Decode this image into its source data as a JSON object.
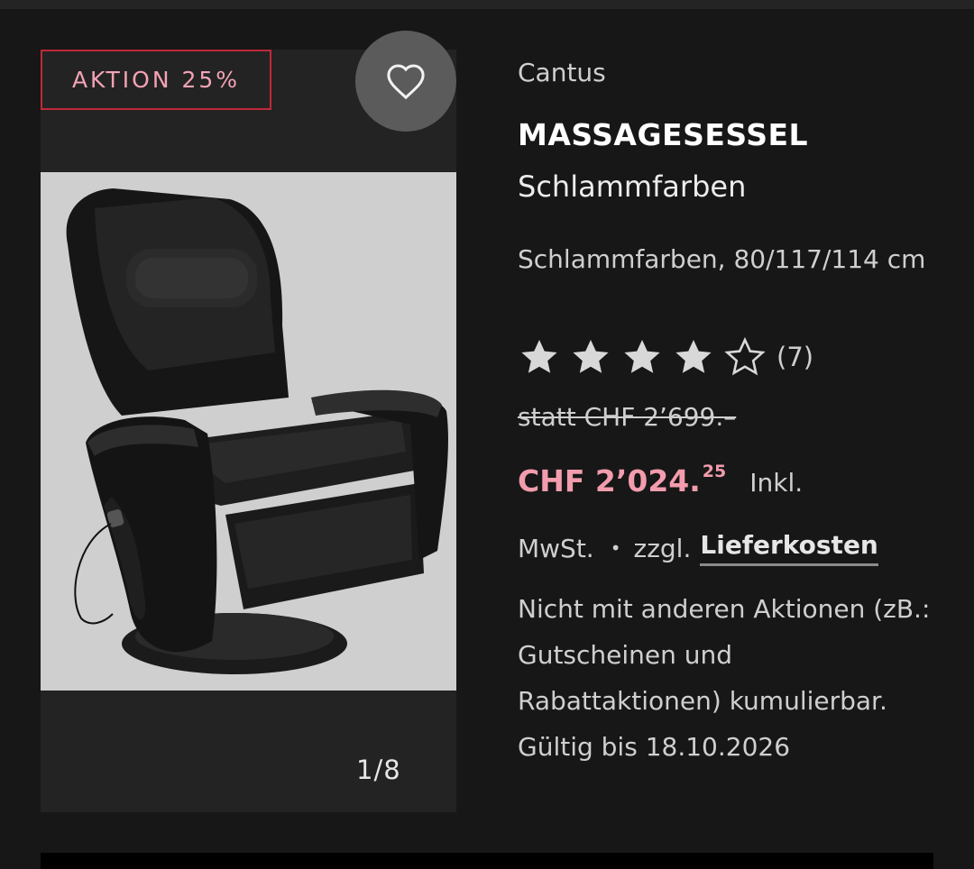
{
  "product": {
    "badge": "AKTION 25%",
    "brand": "Cantus",
    "title": "MASSAGESESSEL",
    "color": "Schlammfarben",
    "variant": "Schlammfarben, 80/117/114 cm",
    "rating": {
      "filled": 4,
      "total": 5,
      "count": "(7)"
    },
    "old_price": "statt CHF 2’699.–",
    "price_main": "CHF 2’024.",
    "price_cents": "25",
    "inkl": "Inkl.",
    "mwst": "MwSt.",
    "separator": "•",
    "zzgl": "zzgl.",
    "delivery_link": "Lieferkosten",
    "note": "Nicht mit anderen Aktionen (zB.: Gutscheinen und Rabattaktionen) kumulierbar. Gültig bis 18.10.2026"
  },
  "gallery": {
    "counter": "1/8"
  },
  "icons": {
    "favorite": "heart-outline-icon",
    "star": "star-icon"
  },
  "colors": {
    "accent": "#f29cad",
    "badge_border": "#c0283a",
    "background": "#171717"
  }
}
